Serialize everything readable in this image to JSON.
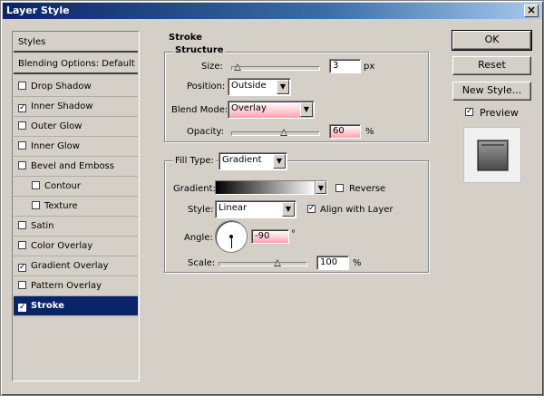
{
  "window": {
    "title": "Layer Style",
    "close_glyph": "×"
  },
  "styles_list": {
    "items": [
      {
        "label": "Styles",
        "type": "header"
      },
      {
        "label": "Blending Options: Default",
        "type": "header"
      },
      {
        "label": "Drop Shadow",
        "checked": false
      },
      {
        "label": "Inner Shadow",
        "checked": true
      },
      {
        "label": "Outer Glow",
        "checked": false
      },
      {
        "label": "Inner Glow",
        "checked": false
      },
      {
        "label": "Bevel and Emboss",
        "checked": false
      },
      {
        "label": "Contour",
        "checked": false,
        "indent": true
      },
      {
        "label": "Texture",
        "checked": false,
        "indent": true
      },
      {
        "label": "Satin",
        "checked": false
      },
      {
        "label": "Color Overlay",
        "checked": false
      },
      {
        "label": "Gradient Overlay",
        "checked": true
      },
      {
        "label": "Pattern Overlay",
        "checked": false
      },
      {
        "label": "Stroke",
        "checked": true,
        "selected": true
      }
    ]
  },
  "stroke": {
    "title": "Stroke",
    "structure": {
      "title": "Structure",
      "size_label": "Size:",
      "size_value": "3",
      "size_unit": "px",
      "size_fraction": 0.02,
      "position_label": "Position:",
      "position_value": "Outside",
      "blend_label": "Blend Mode:",
      "blend_value": "Overlay",
      "opacity_label": "Opacity:",
      "opacity_value": "60",
      "opacity_unit": "%",
      "opacity_fraction": 0.6
    },
    "fill": {
      "fill_type_label": "Fill Type:",
      "fill_type_value": "Gradient",
      "gradient_label": "Gradient:",
      "reverse_label": "Reverse",
      "reverse_checked": false,
      "style_label": "Style:",
      "style_value": "Linear",
      "align_label": "Align with Layer",
      "align_checked": true,
      "angle_label": "Angle:",
      "angle_value": "-90",
      "angle_unit": "°",
      "scale_label": "Scale:",
      "scale_value": "100",
      "scale_unit": "%",
      "scale_fraction": 0.67
    }
  },
  "actions": {
    "ok": "OK",
    "reset": "Reset",
    "new_style": "New Style...",
    "preview_label": "Preview",
    "preview_checked": true
  },
  "colors": {
    "selection": "#0a246a",
    "dialog_bg": "#d4d0c8",
    "highlight_field": "#ff9eb0"
  }
}
